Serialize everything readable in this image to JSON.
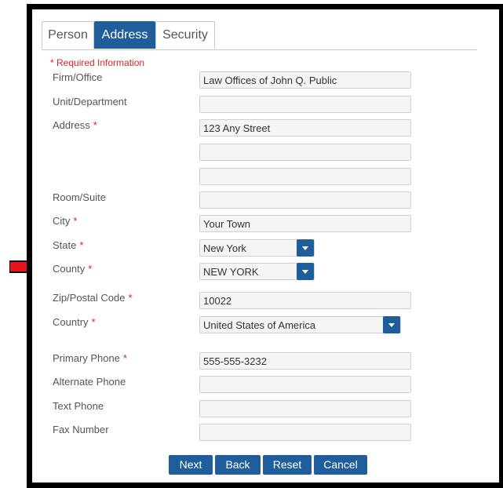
{
  "tabs": [
    {
      "label": "Person",
      "active": false
    },
    {
      "label": "Address",
      "active": true
    },
    {
      "label": "Security",
      "active": false
    }
  ],
  "required_note": "* Required Information",
  "fields": {
    "firm": {
      "label": "Firm/Office",
      "value": "Law Offices of John Q. Public"
    },
    "unit": {
      "label": "Unit/Department",
      "value": ""
    },
    "address": {
      "label": "Address",
      "required": "*",
      "value1": "123 Any Street",
      "value2": "",
      "value3": ""
    },
    "room": {
      "label": "Room/Suite",
      "value": ""
    },
    "city": {
      "label": "City",
      "required": "*",
      "value": "Your Town"
    },
    "state": {
      "label": "State",
      "required": "*",
      "value": "New York"
    },
    "county": {
      "label": "County",
      "required": "*",
      "value": "NEW YORK"
    },
    "zip": {
      "label": "Zip/Postal Code",
      "required": "*",
      "value": "10022"
    },
    "country": {
      "label": "Country",
      "required": "*",
      "value": "United States of America"
    },
    "primary_phone": {
      "label": "Primary Phone",
      "required": "*",
      "value": "555-555-3232"
    },
    "alternate_phone": {
      "label": "Alternate Phone",
      "value": ""
    },
    "text_phone": {
      "label": "Text Phone",
      "value": ""
    },
    "fax": {
      "label": "Fax Number",
      "value": ""
    }
  },
  "buttons": {
    "next": "Next",
    "back": "Back",
    "reset": "Reset",
    "cancel": "Cancel"
  },
  "icons": {
    "pointer": "red-right-arrow-icon",
    "dropdown": "chevron-down-icon"
  },
  "colors": {
    "accent": "#1f5d9b",
    "required": "#d9232a",
    "arrow": "#e8141b"
  }
}
